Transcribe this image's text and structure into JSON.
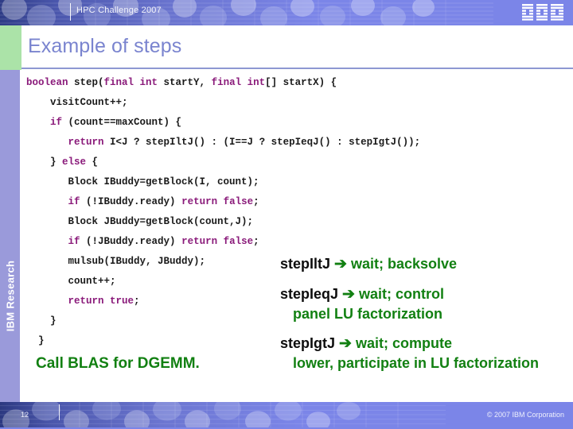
{
  "header": {
    "title": "HPC Challenge 2007",
    "logo": "ibm-logo"
  },
  "slide": {
    "title": "Example of steps"
  },
  "code": {
    "language": "java",
    "keyword_color": "#8a1a7a",
    "text_color": "#1a1a1a",
    "lines": [
      [
        {
          "t": "boolean",
          "k": true
        },
        {
          "t": " step(",
          "k": false
        },
        {
          "t": "final int",
          "k": true
        },
        {
          "t": " startY, ",
          "k": false
        },
        {
          "t": "final int",
          "k": true
        },
        {
          "t": "[] startX) {",
          "k": false
        }
      ],
      [
        {
          "t": "    visitCount++;",
          "k": false
        }
      ],
      [
        {
          "t": "    ",
          "k": false
        },
        {
          "t": "if",
          "k": true
        },
        {
          "t": " (count==maxCount) {",
          "k": false
        }
      ],
      [
        {
          "t": "       ",
          "k": false
        },
        {
          "t": "return",
          "k": true
        },
        {
          "t": " I<J ? stepIltJ() : (I==J ? stepIeqJ() : stepIgtJ());",
          "k": false
        }
      ],
      [
        {
          "t": "    } ",
          "k": false
        },
        {
          "t": "else",
          "k": true
        },
        {
          "t": " {",
          "k": false
        }
      ],
      [
        {
          "t": "       Block IBuddy=getBlock(I, count);",
          "k": false
        }
      ],
      [
        {
          "t": "       ",
          "k": false
        },
        {
          "t": "if",
          "k": true
        },
        {
          "t": " (!IBuddy.ready) ",
          "k": false
        },
        {
          "t": "return false",
          "k": true
        },
        {
          "t": ";",
          "k": false
        }
      ],
      [
        {
          "t": "       Block JBuddy=getBlock(count,J);",
          "k": false
        }
      ],
      [
        {
          "t": "       ",
          "k": false
        },
        {
          "t": "if",
          "k": true
        },
        {
          "t": " (!JBuddy.ready) ",
          "k": false
        },
        {
          "t": "return false",
          "k": true
        },
        {
          "t": ";",
          "k": false
        }
      ],
      [
        {
          "t": "       mulsub(IBuddy, JBuddy);",
          "k": false
        }
      ],
      [
        {
          "t": "       count++;",
          "k": false
        }
      ],
      [
        {
          "t": "       ",
          "k": false
        },
        {
          "t": "return true",
          "k": true
        },
        {
          "t": ";",
          "k": false
        }
      ],
      [
        {
          "t": "    }",
          "k": false
        }
      ],
      [
        {
          "t": "  }",
          "k": false
        }
      ]
    ]
  },
  "callout": {
    "blas_text": "Call BLAS for DGEMM.",
    "color": "#128012"
  },
  "annotations": [
    {
      "method": "stepIltJ",
      "arrow": "➔",
      "description": "wait; backsolve",
      "continuation": ""
    },
    {
      "method": "stepIeqJ",
      "arrow": "➔",
      "description": "wait; control",
      "continuation": "panel LU factorization"
    },
    {
      "method": "stepIgtJ",
      "arrow": "➔",
      "description": "wait; compute",
      "continuation": "lower, participate in LU factorization"
    }
  ],
  "sidebar": {
    "label": "IBM Research"
  },
  "footer": {
    "page_number": "12",
    "copyright": "© 2007 IBM Corporation"
  },
  "colors": {
    "banner": "#7b85e8",
    "rail": "#9a9ada",
    "green_block": "#abe3a8",
    "title": "#7a84cf",
    "annotation_green": "#128012"
  }
}
